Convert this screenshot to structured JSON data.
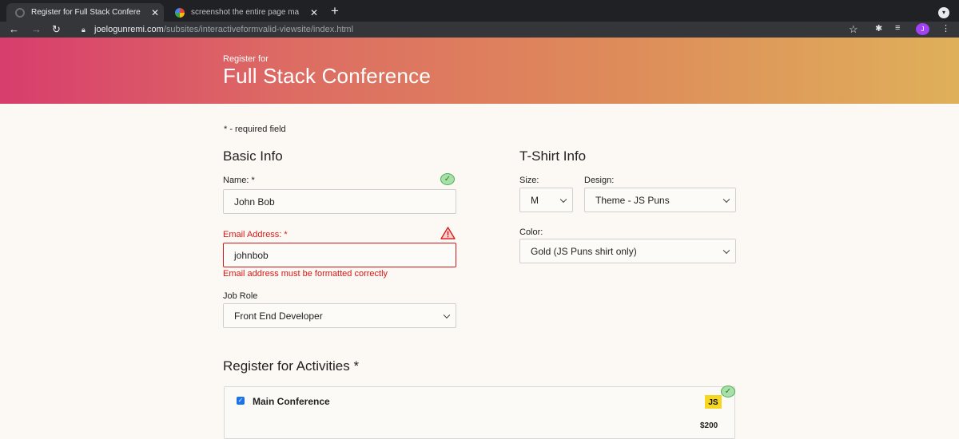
{
  "browser": {
    "tabs": [
      {
        "title": "Register for Full Stack Confere",
        "active": true
      },
      {
        "title": "screenshot the entire page ma",
        "active": false
      }
    ],
    "tab_close": "✕",
    "new_tab": "+",
    "url_host": "joelogunremi.com",
    "url_path": "/subsites/interactiveformvalid-viewsite/index.html",
    "profile_initial": "J"
  },
  "header": {
    "subtitle": "Register for",
    "title": "Full Stack Conference"
  },
  "form": {
    "required_note": "* - required field",
    "basic_info": {
      "heading": "Basic Info",
      "name_label": "Name: *",
      "name_value": "John Bob",
      "name_status": "valid",
      "email_label": "Email Address: *",
      "email_value": "johnbob",
      "email_status": "invalid",
      "email_error": "Email address must be formatted correctly",
      "job_role_label": "Job Role",
      "job_role_value": "Front End Developer"
    },
    "tshirt_info": {
      "heading": "T-Shirt Info",
      "size_label": "Size:",
      "size_value": "M",
      "design_label": "Design:",
      "design_value": "Theme - JS Puns",
      "color_label": "Color:",
      "color_value": "Gold (JS Puns shirt only)"
    },
    "activities": {
      "heading": "Register for Activities *",
      "items": [
        {
          "name": "Main Conference",
          "checked": true,
          "badge": "JS",
          "price": "$200",
          "status": "valid"
        }
      ]
    }
  },
  "colors": {
    "error": "#d81818",
    "valid": "#4caf50",
    "gradient_start": "#d83d6d",
    "gradient_end": "#dfb05a",
    "js_badge": "#f5d623"
  }
}
